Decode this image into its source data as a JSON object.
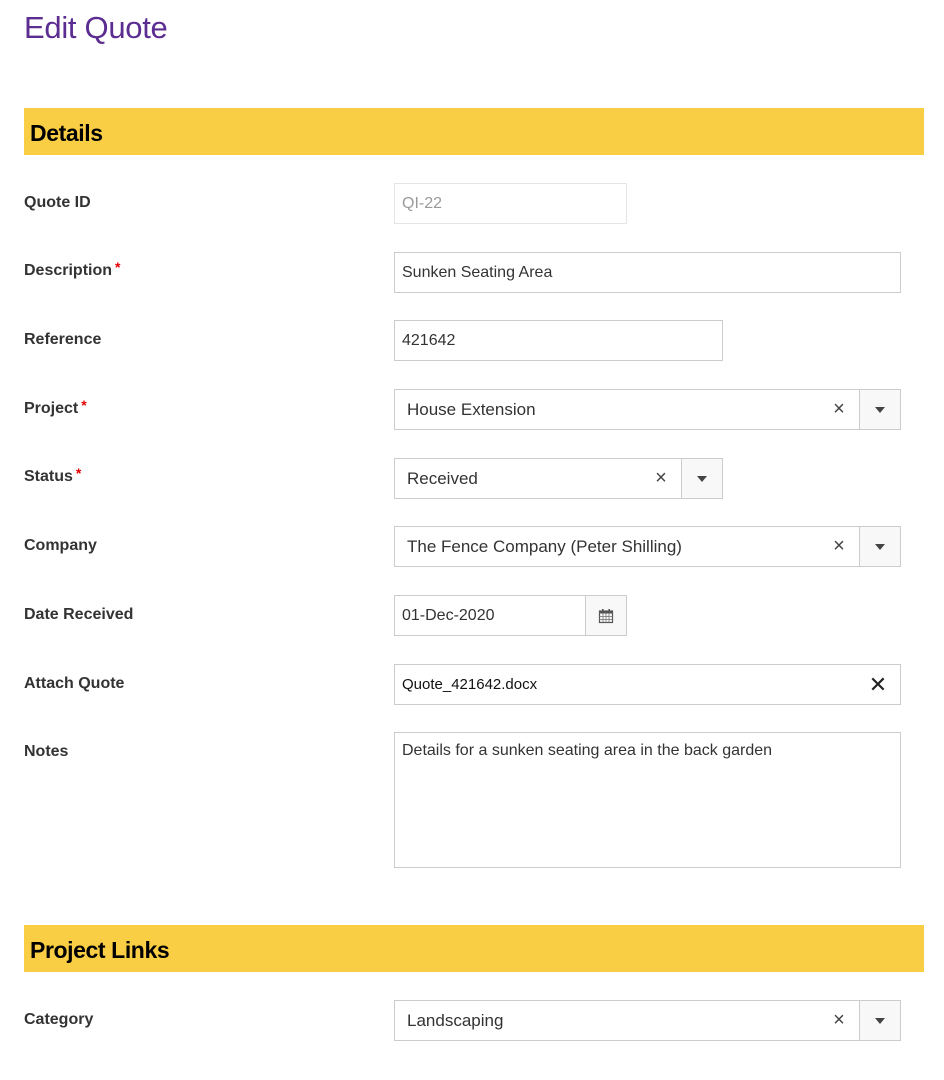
{
  "page": {
    "title": "Edit Quote"
  },
  "sections": {
    "details": {
      "title": "Details"
    },
    "project_links": {
      "title": "Project Links"
    }
  },
  "fields": {
    "quote_id": {
      "label": "Quote ID",
      "value": "QI-22",
      "readonly": true
    },
    "description": {
      "label": "Description",
      "required": true,
      "value": "Sunken Seating Area"
    },
    "reference": {
      "label": "Reference",
      "value": "421642"
    },
    "project": {
      "label": "Project",
      "required": true,
      "value": "House Extension"
    },
    "status": {
      "label": "Status",
      "required": true,
      "value": "Received"
    },
    "company": {
      "label": "Company",
      "value": "The Fence Company (Peter Shilling)"
    },
    "date_received": {
      "label": "Date Received",
      "value": "01-Dec-2020"
    },
    "attach_quote": {
      "label": "Attach Quote",
      "value": "Quote_421642.docx"
    },
    "notes": {
      "label": "Notes",
      "value": "Details for a sunken seating area in the back garden"
    },
    "category": {
      "label": "Category",
      "value": "Landscaping"
    }
  },
  "symbols": {
    "required_marker": "*",
    "clear": "×",
    "remove_file": "✕"
  },
  "colors": {
    "title": "#5b2d91",
    "banner": "#f9ce45",
    "required": "#e00000"
  }
}
